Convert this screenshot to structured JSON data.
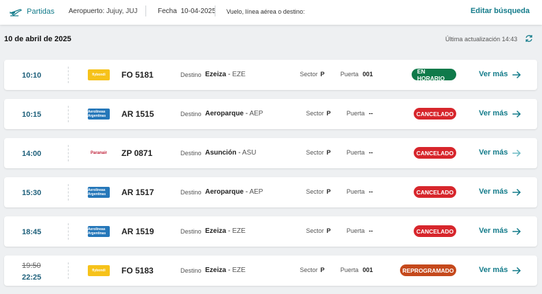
{
  "topbar": {
    "type_label": "Partidas",
    "airport_label": "Aeropuerto:",
    "airport_value": "Jujuy, JUJ",
    "fecha_label": "Fecha",
    "fecha_value": "10-04-2025",
    "search_placeholder": "Vuelo, línea aérea o destino:",
    "edit_label": "Editar búsqueda"
  },
  "header": {
    "date_title": "10 de abril de 2025",
    "updated": "Última actualización 14:43"
  },
  "labels": {
    "destino": "Destino",
    "sector": "Sector",
    "puerta": "Puerta",
    "ver_mas": "Ver más"
  },
  "colors": {
    "accent": "#137b8a",
    "on_time": "#0f7a4a",
    "cancelled": "#d7262c",
    "rescheduled": "#c5491c"
  },
  "flights": [
    {
      "time": "10:10",
      "airline": "flybondi",
      "logo_text": "flybondi",
      "flight": "FO 5181",
      "dest_name": "Ezeiza",
      "dest_code": "EZE",
      "sector": "P",
      "puerta": "001",
      "status": "EN HORARIO"
    },
    {
      "time": "10:15",
      "airline": "aerolineas",
      "logo_text": "Aerolíneas Argentinas",
      "flight": "AR 1515",
      "dest_name": "Aeroparque",
      "dest_code": "AEP",
      "sector": "P",
      "puerta": "--",
      "status": "CANCELADO"
    },
    {
      "time": "14:00",
      "airline": "paranair",
      "logo_text": "Paranair",
      "flight": "ZP 0871",
      "dest_name": "Asunción",
      "dest_code": "ASU",
      "sector": "P",
      "puerta": "--",
      "status": "CANCELADO"
    },
    {
      "time": "15:30",
      "airline": "aerolineas",
      "logo_text": "Aerolíneas Argentinas",
      "flight": "AR 1517",
      "dest_name": "Aeroparque",
      "dest_code": "AEP",
      "sector": "P",
      "puerta": "--",
      "status": "CANCELADO"
    },
    {
      "time": "18:45",
      "airline": "aerolineas",
      "logo_text": "Aerolíneas Argentinas",
      "flight": "AR 1519",
      "dest_name": "Ezeiza",
      "dest_code": "EZE",
      "sector": "P",
      "puerta": "--",
      "status": "CANCELADO"
    },
    {
      "time_old": "19:50",
      "time": "22:25",
      "airline": "flybondi",
      "logo_text": "flybondi",
      "flight": "FO 5183",
      "dest_name": "Ezeiza",
      "dest_code": "EZE",
      "sector": "P",
      "puerta": "001",
      "status": "REPROGRAMADO"
    }
  ]
}
